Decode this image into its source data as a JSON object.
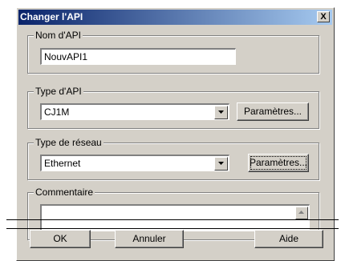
{
  "dialog": {
    "title": "Changer l'API",
    "close_label": "X"
  },
  "nom_api": {
    "legend": "Nom d'API",
    "value": "NouvAPI1"
  },
  "type_api": {
    "legend": "Type d'API",
    "selected": "CJ1M",
    "params_label": "Paramètres..."
  },
  "type_reseau": {
    "legend": "Type de réseau",
    "selected": "Ethernet",
    "params_label": "Paramètres..."
  },
  "commentaire": {
    "legend": "Commentaire"
  },
  "buttons": {
    "ok": "OK",
    "annuler": "Annuler",
    "aide": "Aide"
  }
}
